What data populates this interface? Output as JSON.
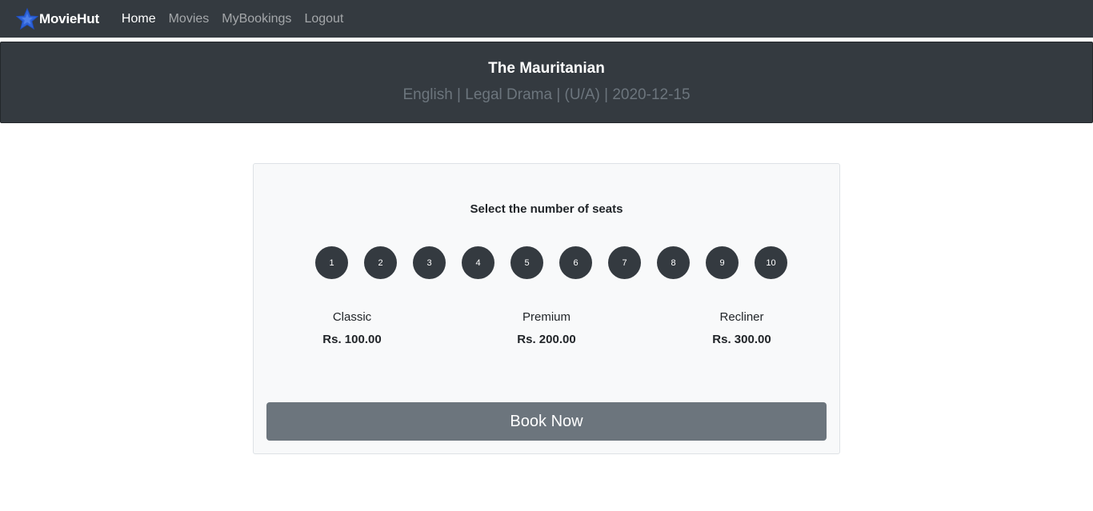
{
  "navbar": {
    "brand": "MovieHut",
    "brand_icon": "star-logo-icon",
    "links": [
      {
        "label": "Home",
        "active": true
      },
      {
        "label": "Movies",
        "active": false
      },
      {
        "label": "MyBookings",
        "active": false
      },
      {
        "label": "Logout",
        "active": false
      }
    ]
  },
  "movie": {
    "title": "The Mauritanian",
    "meta": "English | Legal Drama | (U/A) | 2020-12-15"
  },
  "booking": {
    "heading": "Select the number of seats",
    "seat_counts": [
      "1",
      "2",
      "3",
      "4",
      "5",
      "6",
      "7",
      "8",
      "9",
      "10"
    ],
    "tiers": [
      {
        "name": "Classic",
        "price": "Rs. 100.00"
      },
      {
        "name": "Premium",
        "price": "Rs. 200.00"
      },
      {
        "name": "Recliner",
        "price": "Rs. 300.00"
      }
    ],
    "book_label": "Book Now"
  },
  "colors": {
    "navbar_bg": "#343a40",
    "seat_bg": "#343a40",
    "book_btn_bg": "#6c757d",
    "card_bg": "#f8f9fa",
    "brand_icon": "#2f63d8"
  }
}
